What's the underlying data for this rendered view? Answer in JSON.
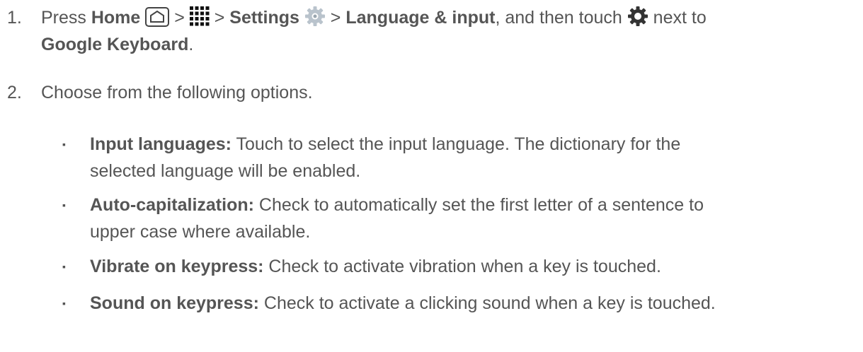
{
  "steps": [
    {
      "num": "1.",
      "t1": "Press ",
      "home": "Home",
      "sep1": " > ",
      "sep2": " > ",
      "settings": "Settings",
      "sep3": " > ",
      "lang": "Language & input",
      "t2": ", and then touch ",
      "t3": " next to",
      "keyboard": "Google Keyboard",
      "t4": "."
    },
    {
      "num": "2.",
      "text": "Choose from the following options."
    }
  ],
  "options": [
    {
      "bullet": "▪",
      "term": "Input languages:",
      "desc_line1": " Touch to select the input language. The dictionary for the",
      "desc_line2": "selected language will be enabled."
    },
    {
      "bullet": "▪",
      "term": "Auto-capitalization:",
      "desc_line1": " Check to automatically set the first letter of a sentence to",
      "desc_line2": "upper case where available."
    },
    {
      "bullet": "▪",
      "term": "Vibrate on keypress:",
      "desc_line1": " Check to activate vibration when a key is touched.",
      "desc_line2": ""
    },
    {
      "bullet": "▪",
      "term": "Sound on keypress:",
      "desc_line1": " Check to activate a clicking sound when a key is touched.",
      "desc_line2": ""
    }
  ]
}
